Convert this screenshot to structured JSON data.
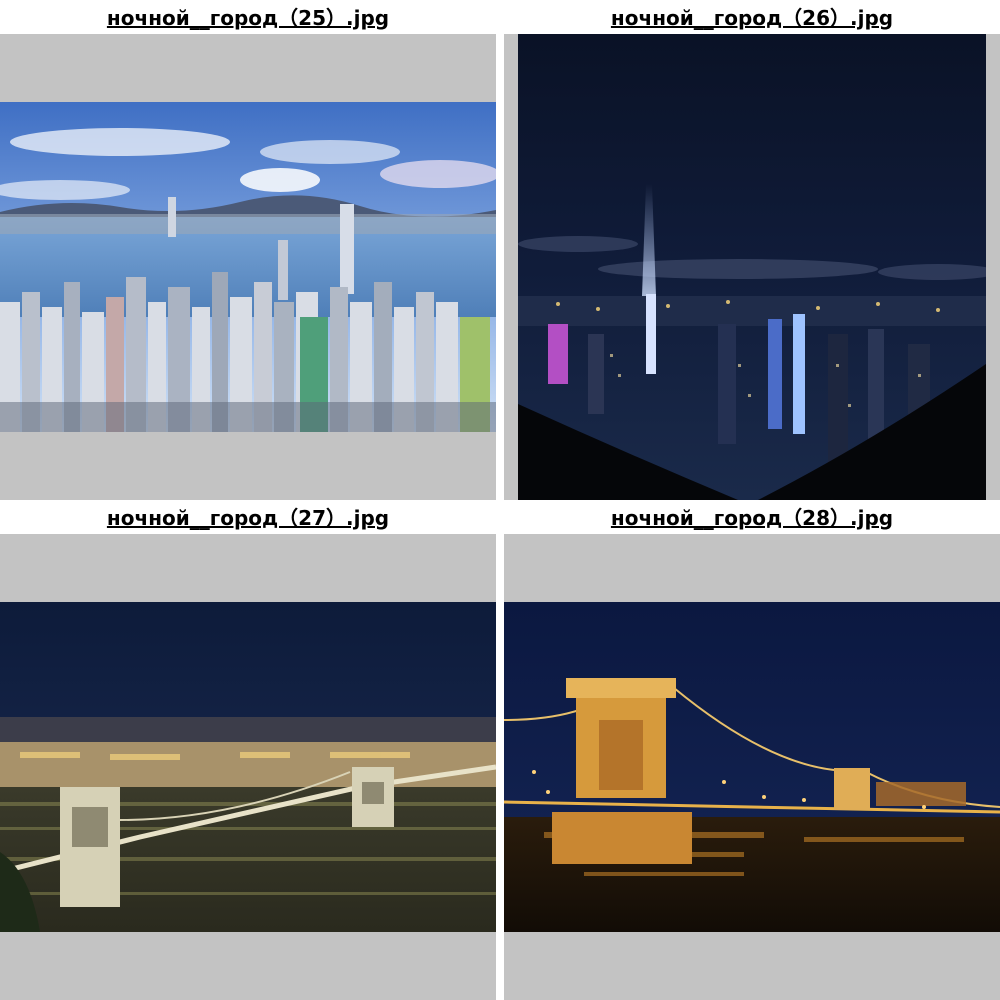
{
  "gallery": {
    "items": [
      {
        "filename": "ночной__город（25）.jpg",
        "scene": "daytime city skyline"
      },
      {
        "filename": "ночной__город（26）.jpg",
        "scene": "night city skyline"
      },
      {
        "filename": "ночной__город（27）.jpg",
        "scene": "illuminated bridge over river"
      },
      {
        "filename": "ночной__город（28）.jpg",
        "scene": "illuminated bridge at night"
      }
    ]
  },
  "colors": {
    "frame_bg": "#c3c3c3",
    "page_bg": "#ffffff",
    "caption_text": "#000000"
  }
}
